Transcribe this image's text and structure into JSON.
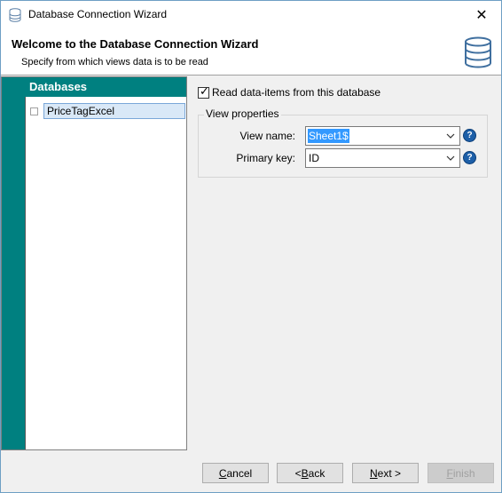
{
  "window": {
    "title": "Database Connection Wizard",
    "close_symbol": "✕",
    "app_icon": "database-icon"
  },
  "header": {
    "title": "Welcome to the Database Connection Wizard",
    "subtitle": "Specify from which views data is to be read",
    "icon": "database-icon"
  },
  "databases": {
    "heading": "Databases",
    "items": [
      {
        "label": "PriceTagExcel",
        "selected": true
      }
    ]
  },
  "options": {
    "read_checkbox_label": "Read data-items from this database",
    "read_checked": true,
    "group_title": "View properties",
    "view_name_label": "View name:",
    "view_name_value": "Sheet1$",
    "primary_key_label": "Primary key:",
    "primary_key_value": "ID",
    "help_symbol": "?"
  },
  "buttons": {
    "cancel": {
      "pre": "",
      "accel": "C",
      "post": "ancel"
    },
    "back": {
      "pre": "< ",
      "accel": "B",
      "post": "ack"
    },
    "next": {
      "pre": "",
      "accel": "N",
      "post": "ext >"
    },
    "finish": {
      "pre": "",
      "accel": "F",
      "post": "inish",
      "enabled": false
    }
  },
  "colors": {
    "accent": "#008080",
    "selection": "#3399ff",
    "help": "#1d5fa8"
  }
}
